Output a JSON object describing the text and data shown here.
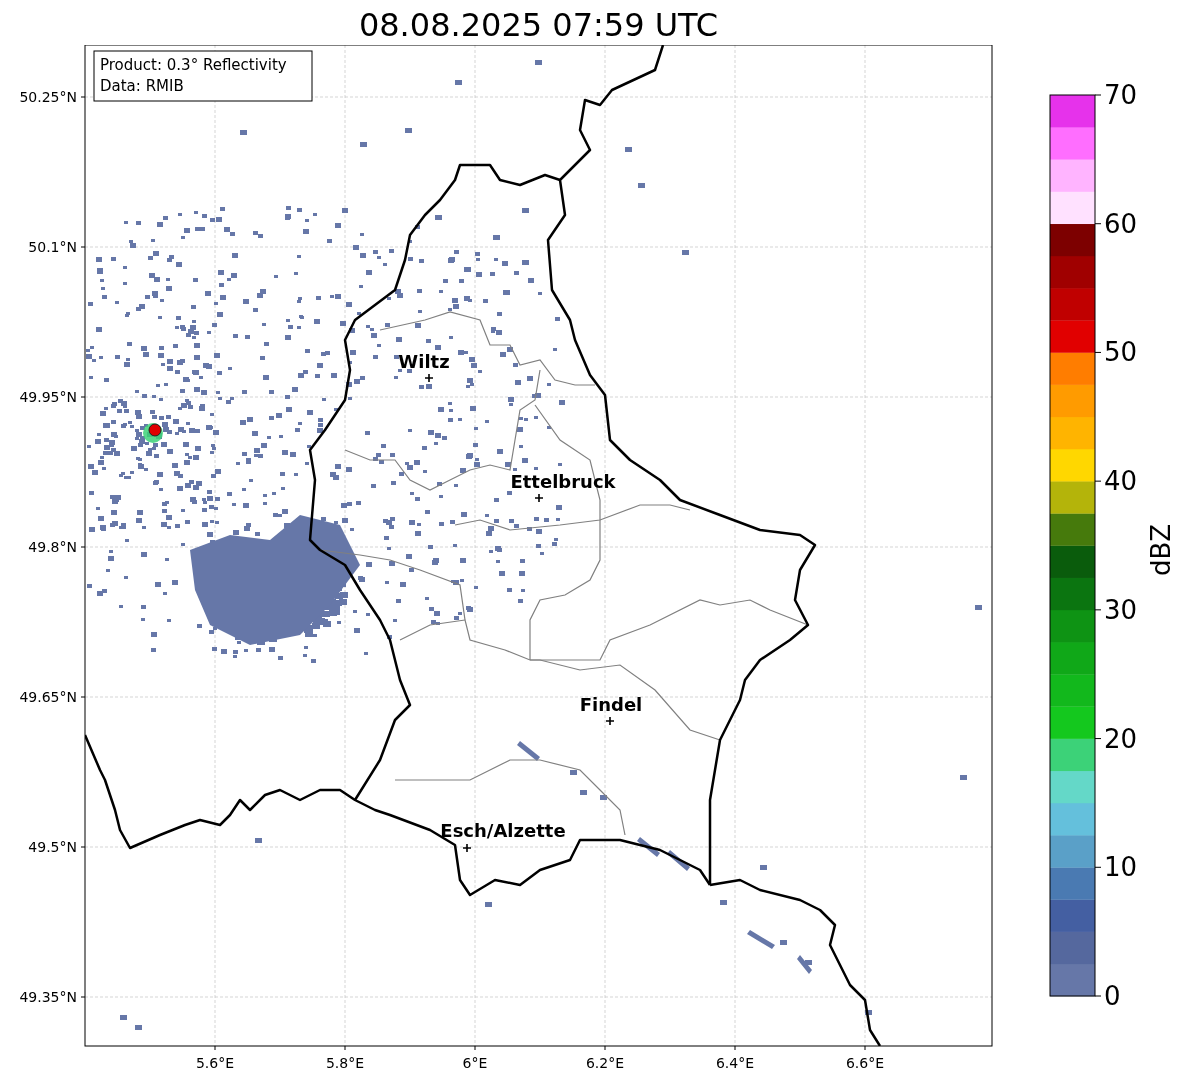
{
  "title": "08.08.2025 07:59 UTC",
  "info_box": {
    "lines": [
      "Product: 0.3° Reflectivity",
      "Data: RMIB"
    ]
  },
  "y_ticks": [
    "50.25°N",
    "50.1°N",
    "49.95°N",
    "49.8°N",
    "49.65°N",
    "49.5°N",
    "49.35°N"
  ],
  "x_ticks": [
    "5.6°E",
    "5.8°E",
    "6°E",
    "6.2°E",
    "6.4°E",
    "6.6°E"
  ],
  "cities": [
    {
      "label": "Wiltz"
    },
    {
      "label": "Ettelbruck"
    },
    {
      "label": "Findel"
    },
    {
      "label": "Esch/Alzette"
    }
  ],
  "colorbar": {
    "label": "dBZ",
    "ticks": [
      "70",
      "60",
      "50",
      "40",
      "30",
      "20",
      "10",
      "0"
    ],
    "bins": [
      {
        "color": "#6677a8"
      },
      {
        "color": "#55689e"
      },
      {
        "color": "#445fa2"
      },
      {
        "color": "#4a7ab2"
      },
      {
        "color": "#5aa0c8"
      },
      {
        "color": "#64c0dc"
      },
      {
        "color": "#64d8c8"
      },
      {
        "color": "#3cd278"
      },
      {
        "color": "#14c81e"
      },
      {
        "color": "#12b81c"
      },
      {
        "color": "#10a818"
      },
      {
        "color": "#0e9314"
      },
      {
        "color": "#0b7510"
      },
      {
        "color": "#0a5c0c"
      },
      {
        "color": "#467a0c"
      },
      {
        "color": "#b4b40a"
      },
      {
        "color": "#ffd700"
      },
      {
        "color": "#ffb400"
      },
      {
        "color": "#ff9b00"
      },
      {
        "color": "#ff7d00"
      },
      {
        "color": "#e10000"
      },
      {
        "color": "#c00000"
      },
      {
        "color": "#a00000"
      },
      {
        "color": "#7d0000"
      },
      {
        "color": "#ffe1ff"
      },
      {
        "color": "#ffb4ff"
      },
      {
        "color": "#ff6eff"
      },
      {
        "color": "#e632eb"
      }
    ]
  }
}
